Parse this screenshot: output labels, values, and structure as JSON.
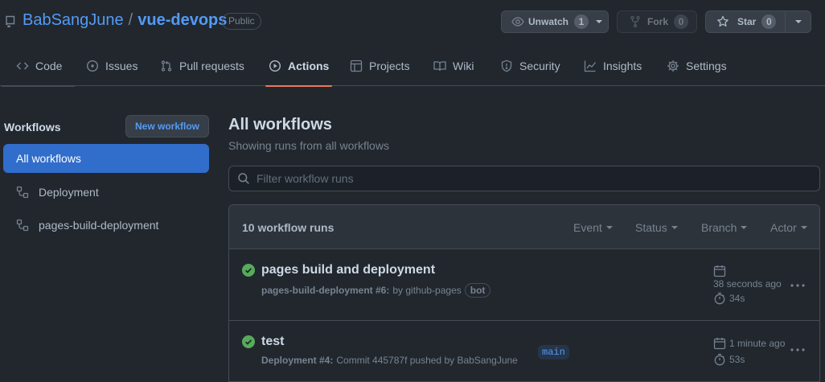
{
  "header": {
    "owner": "BabSangJune",
    "separator": "/",
    "repo": "vue-devops",
    "visibility": "Public",
    "watch": {
      "label": "Unwatch",
      "count": "1"
    },
    "fork": {
      "label": "Fork",
      "count": "0"
    },
    "star": {
      "label": "Star",
      "count": "0"
    }
  },
  "tabs": [
    {
      "label": "Code",
      "icon": "code-icon"
    },
    {
      "label": "Issues",
      "icon": "issue-icon"
    },
    {
      "label": "Pull requests",
      "icon": "pull-request-icon"
    },
    {
      "label": "Actions",
      "icon": "play-icon",
      "active": true
    },
    {
      "label": "Projects",
      "icon": "table-icon"
    },
    {
      "label": "Wiki",
      "icon": "book-icon"
    },
    {
      "label": "Security",
      "icon": "shield-icon"
    },
    {
      "label": "Insights",
      "icon": "graph-icon"
    },
    {
      "label": "Settings",
      "icon": "gear-icon"
    }
  ],
  "sidebar": {
    "title": "Workflows",
    "new_workflow": "New workflow",
    "items": [
      {
        "label": "All workflows",
        "active": true
      },
      {
        "label": "Deployment",
        "icon": "workflow-icon"
      },
      {
        "label": "pages-build-deployment",
        "icon": "workflow-icon"
      }
    ]
  },
  "main": {
    "title": "All workflows",
    "subtitle": "Showing runs from all workflows",
    "filter_placeholder": "Filter workflow runs",
    "runs_count": "10 workflow runs",
    "filters": [
      "Event",
      "Status",
      "Branch",
      "Actor"
    ],
    "runs": [
      {
        "title": "pages build and deployment",
        "workflow": "pages-build-deployment #6:",
        "detail": "by github-pages",
        "badge": "bot",
        "time": "38 seconds ago",
        "duration": "34s",
        "status": "success"
      },
      {
        "title": "test",
        "workflow": "Deployment #4:",
        "detail": "Commit 445787f pushed by BabSangJune",
        "branch": "main",
        "time": "1 minute ago",
        "duration": "53s",
        "status": "success"
      }
    ]
  },
  "colors": {
    "background": "#22272e",
    "accent": "#539bf5",
    "active_tab_underline": "#ec775c",
    "selected_item": "#316dca",
    "success": "#57ab5a"
  }
}
